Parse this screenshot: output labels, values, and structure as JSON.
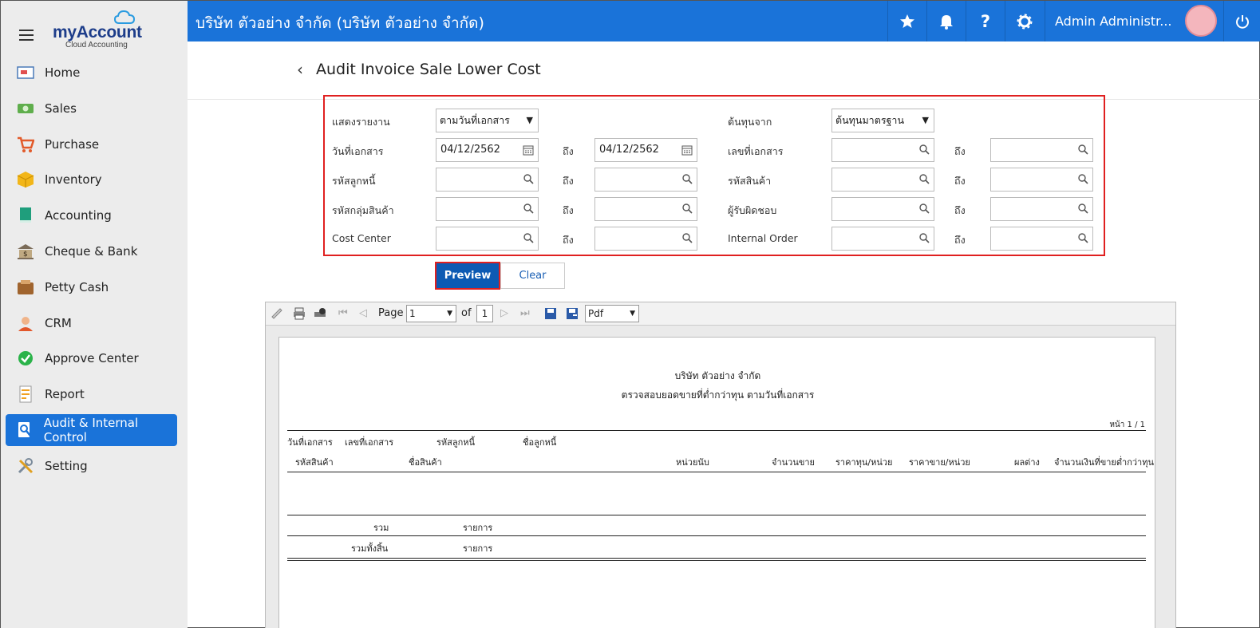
{
  "brand": {
    "name_my": "my",
    "name_account": "Account",
    "tagline": "Cloud Accounting"
  },
  "sidebar": {
    "items": [
      {
        "label": "Home",
        "icon": "home-icon"
      },
      {
        "label": "Sales",
        "icon": "sales-icon"
      },
      {
        "label": "Purchase",
        "icon": "cart-icon"
      },
      {
        "label": "Inventory",
        "icon": "box-icon"
      },
      {
        "label": "Accounting",
        "icon": "book-icon"
      },
      {
        "label": "Cheque & Bank",
        "icon": "bank-icon"
      },
      {
        "label": "Petty Cash",
        "icon": "wallet-icon"
      },
      {
        "label": "CRM",
        "icon": "crm-icon"
      },
      {
        "label": "Approve Center",
        "icon": "check-circle-icon"
      },
      {
        "label": "Report",
        "icon": "report-icon"
      },
      {
        "label": "Audit & Internal Control",
        "icon": "audit-icon",
        "active": true
      },
      {
        "label": "Setting",
        "icon": "tools-icon"
      }
    ]
  },
  "topbar": {
    "company": "บริษัท ตัวอย่าง จำกัด (บริษัท ตัวอย่าง จำกัด)",
    "user": "Admin Administr...",
    "accent": "#1a73d9"
  },
  "page": {
    "title": "Audit Invoice Sale Lower Cost"
  },
  "filters": {
    "show_report_label": "แสดงรายงาน",
    "show_report_value": "ตามวันที่เอกสาร",
    "cost_from_label": "ต้นทุนจาก",
    "cost_from_value": "ต้นทุนมาตรฐาน",
    "doc_date_label": "วันที่เอกสาร",
    "doc_date_from": "04/12/2562",
    "doc_date_to": "04/12/2562",
    "doc_no_label": "เลขที่เอกสาร",
    "debtor_code_label": "รหัสลูกหนี้",
    "product_code_label": "รหัสสินค้า",
    "product_group_label": "รหัสกลุ่มสินค้า",
    "responsible_label": "ผู้รับผิดชอบ",
    "cost_center_label": "Cost Center",
    "internal_order_label": "Internal Order",
    "to_label": "ถึง"
  },
  "buttons": {
    "preview": "Preview",
    "clear": "Clear"
  },
  "viewer": {
    "page_label": "Page",
    "page_value": "1",
    "of_label": "of",
    "total_pages": "1",
    "format": "Pdf"
  },
  "report": {
    "company": "บริษัท ตัวอย่าง จำกัด",
    "title": "ตรวจสอบยอดขายที่ต่ำกว่าทุน ตามวันที่เอกสาร",
    "page_no": "หน้า 1 / 1",
    "headers_row1": [
      "วันที่เอกสาร",
      "เลขที่เอกสาร",
      "รหัสลูกหนี้",
      "ชื่อลูกหนี้"
    ],
    "headers_row2": [
      "รหัสสินค้า",
      "ชื่อสินค้า",
      "หน่วยนับ",
      "จำนวนขาย",
      "ราคาทุน/หน่วย",
      "ราคาขาย/หน่วย",
      "ผลต่าง",
      "จำนวนเงินที่ขายต่ำกว่าทุน"
    ],
    "sum_label": "รวม",
    "sum_items": "รายการ",
    "grand_total_label": "รวมทั้งสิ้น",
    "grand_total_items": "รายการ"
  }
}
